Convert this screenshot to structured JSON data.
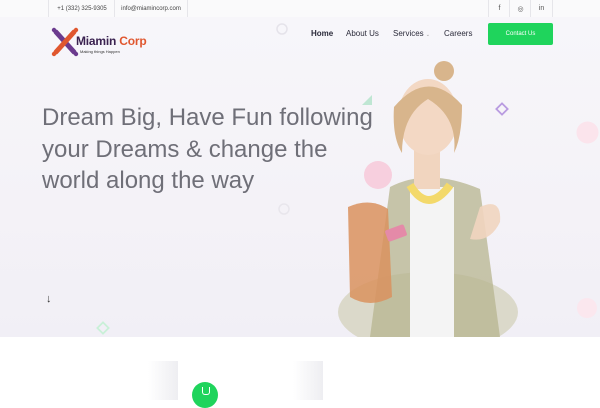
{
  "topbar": {
    "phone": "+1 (332) 325-9305",
    "email": "info@miamincorp.com",
    "social": [
      {
        "icon": "facebook-icon",
        "glyph": "f"
      },
      {
        "icon": "instagram-icon",
        "glyph": "◎"
      },
      {
        "icon": "linkedin-icon",
        "glyph": "in"
      }
    ]
  },
  "brand": {
    "name_part1": "Miamin",
    "name_part2": "Corp",
    "tagline": "Making things Happen",
    "colors": {
      "primary": "#3a2250",
      "accent": "#e0572f",
      "button": "#1fd45c"
    }
  },
  "nav": {
    "items": [
      {
        "label": "Home"
      },
      {
        "label": "About Us"
      },
      {
        "label": "Services"
      },
      {
        "label": "Careers"
      }
    ],
    "services_caret": "⌄",
    "contact_label": "Contact Us"
  },
  "hero": {
    "headline": "Dream Big, Have Fun following your Dreams & change the world along the way",
    "scroll_glyph": "↓"
  }
}
